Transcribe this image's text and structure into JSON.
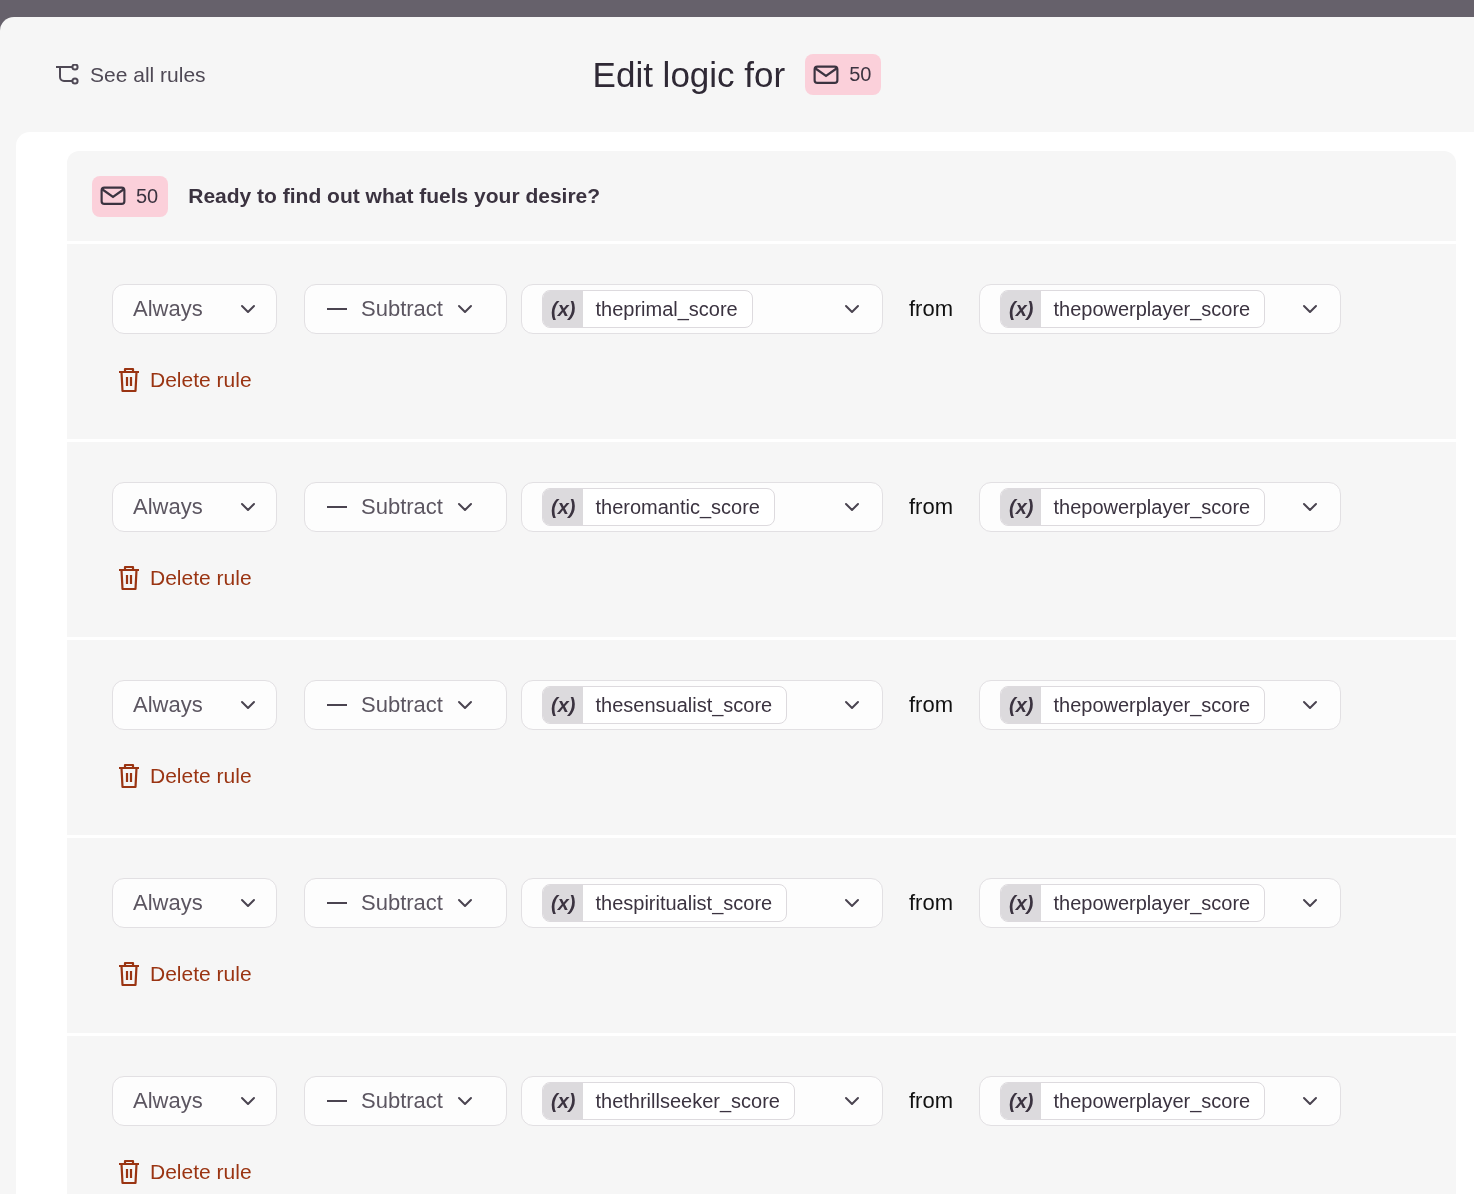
{
  "header": {
    "back_link": "See all rules",
    "title": "Edit logic for",
    "badge": "50"
  },
  "question": {
    "badge": "50",
    "text": "Ready to find out what fuels your desire?"
  },
  "rules": [
    {
      "condition": "Always",
      "operation": "Subtract",
      "variable_symbol": "(x)",
      "variable": "theprimal_score",
      "connector": "from",
      "target_symbol": "(x)",
      "target": "thepowerplayer_score",
      "delete_label": "Delete rule"
    },
    {
      "condition": "Always",
      "operation": "Subtract",
      "variable_symbol": "(x)",
      "variable": "theromantic_score",
      "connector": "from",
      "target_symbol": "(x)",
      "target": "thepowerplayer_score",
      "delete_label": "Delete rule"
    },
    {
      "condition": "Always",
      "operation": "Subtract",
      "variable_symbol": "(x)",
      "variable": "thesensualist_score",
      "connector": "from",
      "target_symbol": "(x)",
      "target": "thepowerplayer_score",
      "delete_label": "Delete rule"
    },
    {
      "condition": "Always",
      "operation": "Subtract",
      "variable_symbol": "(x)",
      "variable": "thespiritualist_score",
      "connector": "from",
      "target_symbol": "(x)",
      "target": "thepowerplayer_score",
      "delete_label": "Delete rule"
    },
    {
      "condition": "Always",
      "operation": "Subtract",
      "variable_symbol": "(x)",
      "variable": "thethrillseeker_score",
      "connector": "from",
      "target_symbol": "(x)",
      "target": "thepowerplayer_score",
      "delete_label": "Delete rule"
    }
  ]
}
